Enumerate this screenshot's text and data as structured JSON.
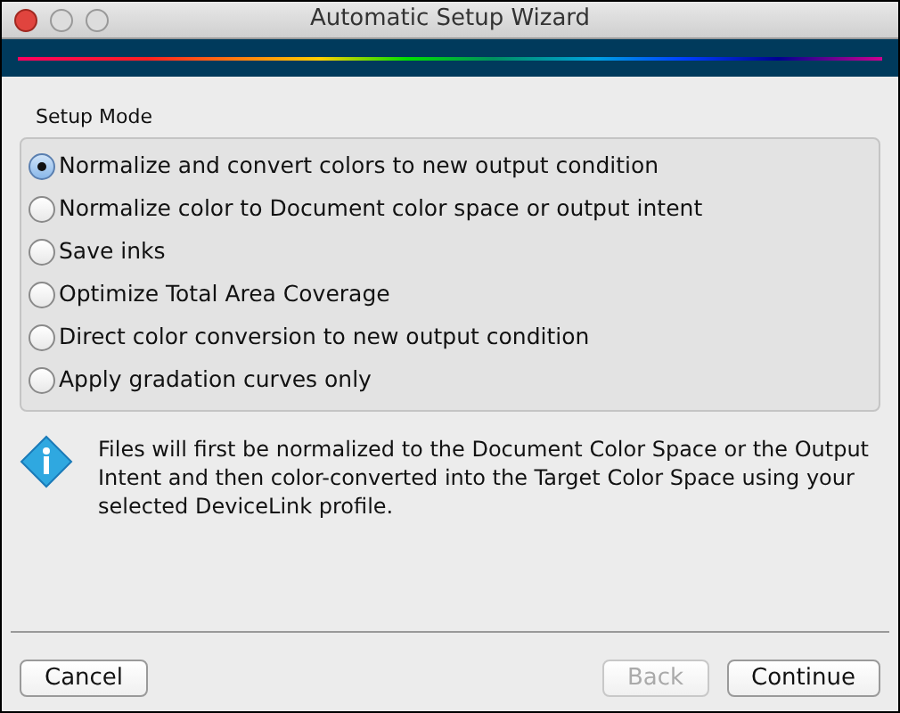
{
  "window": {
    "title": "Automatic Setup Wizard"
  },
  "setup_mode": {
    "label": "Setup Mode",
    "options": [
      {
        "label": "Normalize and convert colors to new output condition",
        "selected": true
      },
      {
        "label": "Normalize color to Document color space or output intent",
        "selected": false
      },
      {
        "label": "Save inks",
        "selected": false
      },
      {
        "label": "Optimize Total Area Coverage",
        "selected": false
      },
      {
        "label": "Direct color conversion to new output condition",
        "selected": false
      },
      {
        "label": "Apply gradation curves only",
        "selected": false
      }
    ]
  },
  "info": {
    "text": "Files will first be normalized to the Document Color Space or the Output Intent and then color-converted into the Target Color Space using your selected DeviceLink profile."
  },
  "left_buttons": [
    {
      "label": "Cancel",
      "disabled": false
    }
  ],
  "right_buttons": [
    {
      "label": "Back",
      "disabled": true
    },
    {
      "label": "Continue",
      "disabled": false
    }
  ]
}
